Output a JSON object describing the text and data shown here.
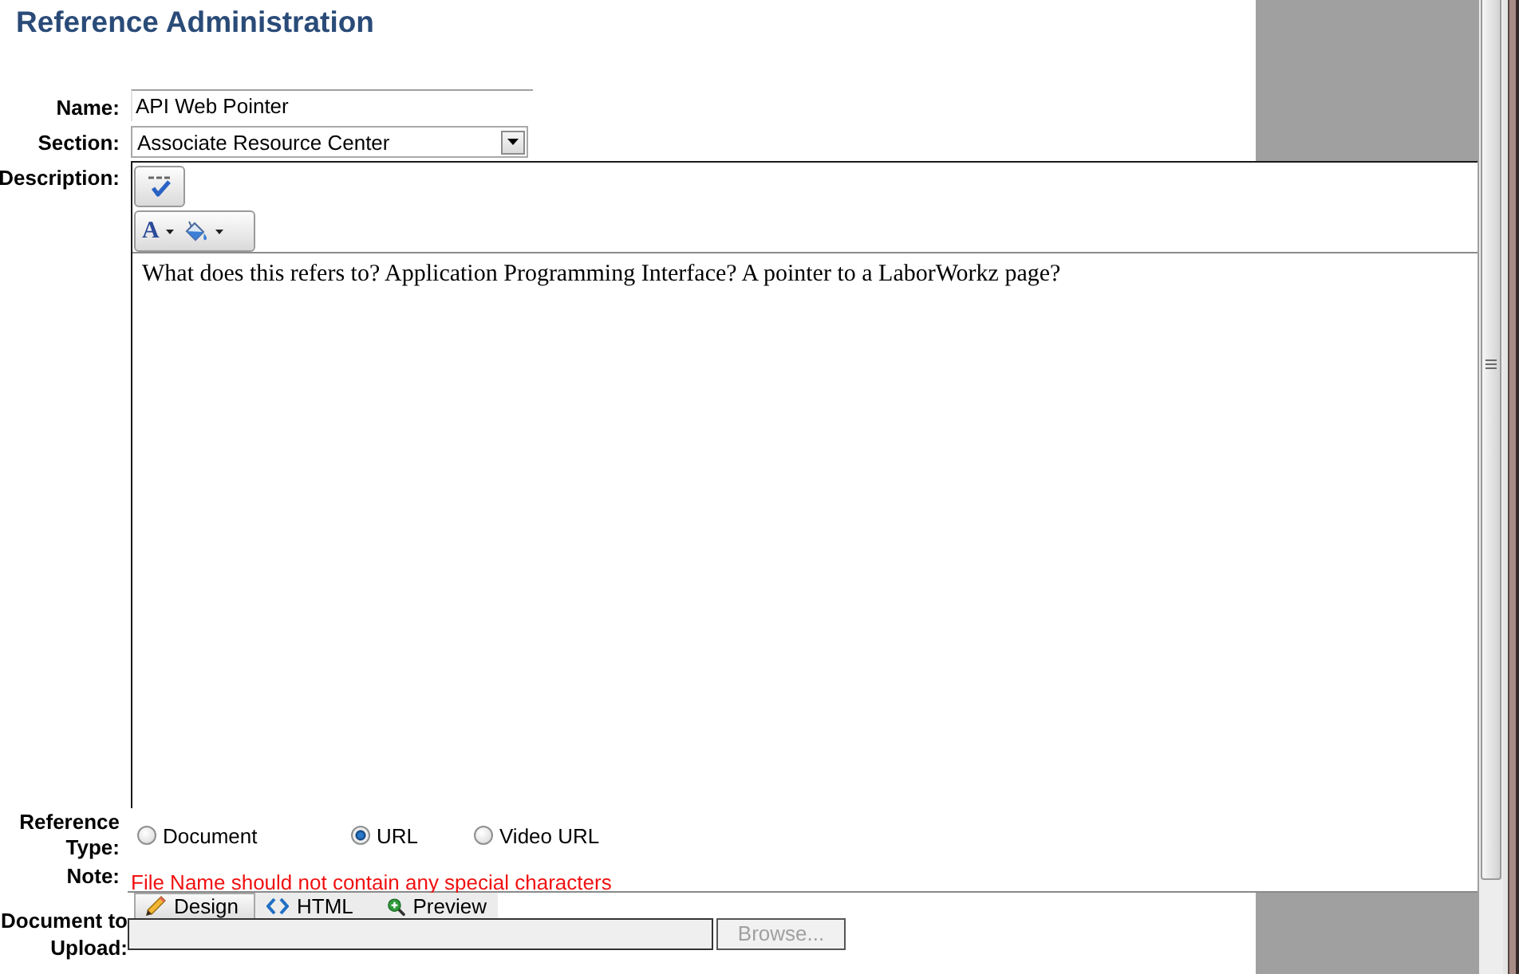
{
  "title": "Reference Administration",
  "name_field": {
    "label": "Name:",
    "value": "API Web Pointer"
  },
  "section_field": {
    "label": "Section:",
    "value": "Associate Resource Center"
  },
  "description": {
    "label": "Description:",
    "font_color_glyph": "A",
    "text": "What does this refers to? Application Programming Interface? A pointer to a LaborWorkz page?",
    "mode_tabs": [
      {
        "kind": "design",
        "label": "Design",
        "selected": true
      },
      {
        "kind": "html",
        "label": "HTML",
        "selected": false
      },
      {
        "kind": "preview",
        "label": "Preview",
        "selected": false
      }
    ]
  },
  "reference_type": {
    "label": "Reference Type:",
    "options": [
      {
        "label": "Document",
        "selected": false
      },
      {
        "label": "URL",
        "selected": true
      },
      {
        "label": "Video URL",
        "selected": false
      }
    ]
  },
  "note": {
    "label": "Note:",
    "text": "File Name should not contain any special characters"
  },
  "upload": {
    "label": "Document to Upload:",
    "file_field": {
      "disabled": true
    },
    "browse_button": {
      "label": "Browse...",
      "disabled": true
    }
  }
}
